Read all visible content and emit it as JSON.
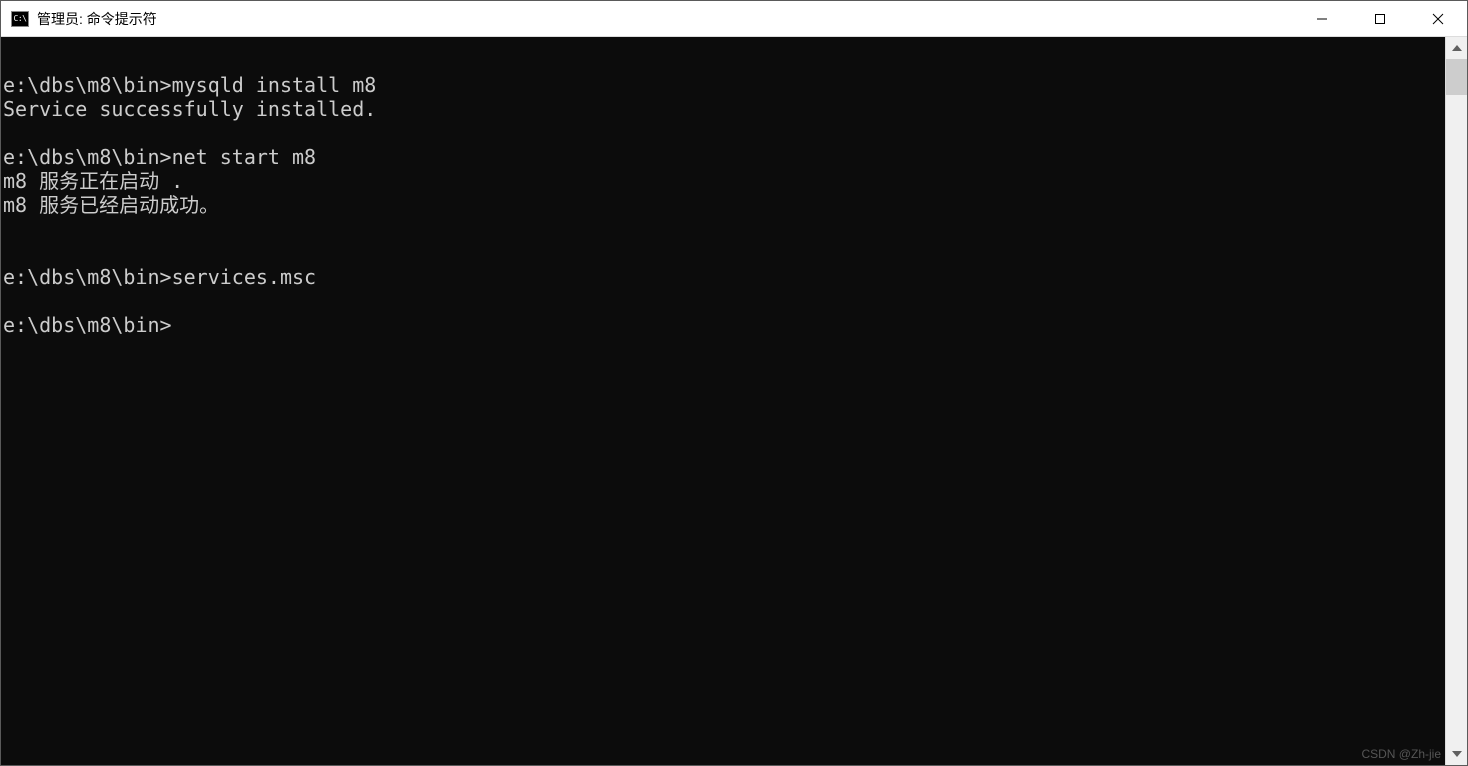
{
  "titlebar": {
    "icon_label": "C:\\",
    "title": "管理员: 命令提示符"
  },
  "terminal": {
    "content": "\ne:\\dbs\\m8\\bin>mysqld install m8\nService successfully installed.\n\ne:\\dbs\\m8\\bin>net start m8\nm8 服务正在启动 .\nm8 服务已经启动成功。\n\n\ne:\\dbs\\m8\\bin>services.msc\n\ne:\\dbs\\m8\\bin>"
  },
  "watermark": "CSDN @Zh-jie"
}
